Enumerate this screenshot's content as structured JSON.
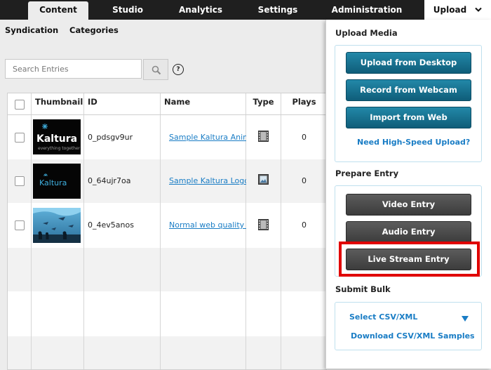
{
  "nav": {
    "tabs": [
      {
        "label": "Content",
        "active": true
      },
      {
        "label": "Studio"
      },
      {
        "label": "Analytics"
      },
      {
        "label": "Settings"
      },
      {
        "label": "Administration"
      },
      {
        "label": "Upload",
        "icon": "chevron-down-icon"
      }
    ]
  },
  "subnav": {
    "items": [
      "Syndication",
      "Categories"
    ]
  },
  "search": {
    "placeholder": "Search Entries",
    "button_icon": "search-icon",
    "help_icon": "help-icon",
    "help_glyph": "?"
  },
  "table": {
    "columns": [
      "Thumbnail",
      "ID",
      "Name",
      "Type",
      "Plays"
    ],
    "rows": [
      {
        "id": "0_pdsgv9ur",
        "name": "Sample Kaltura Animated Logo",
        "type_icon": "video-icon",
        "plays": "0",
        "thumb_logo": "Kaltura",
        "thumb_tagline": "everything together"
      },
      {
        "id": "0_64ujr7oa",
        "name": "Sample Kaltura Logo",
        "type_icon": "image-icon",
        "plays": "0",
        "thumb_logo": "Kaltura",
        "thumb_tagline": ""
      },
      {
        "id": "0_4ev5anos",
        "name": "Normal web quality video",
        "type_icon": "video-icon",
        "plays": "0",
        "thumb_logo": "",
        "thumb_tagline": ""
      }
    ]
  },
  "upload_panel": {
    "upload_media": {
      "title": "Upload Media",
      "buttons": [
        "Upload from Desktop",
        "Record from Webcam",
        "Import from Web"
      ],
      "link": "Need High-Speed Upload?"
    },
    "prepare_entry": {
      "title": "Prepare Entry",
      "buttons": [
        "Video Entry",
        "Audio Entry",
        "Live Stream Entry"
      ],
      "highlighted": "Live Stream Entry",
      "highlight_color": "#e00000"
    },
    "submit_bulk": {
      "title": "Submit Bulk",
      "select": "Select CSV/XML",
      "select_icon": "triangle-down-icon",
      "download": "Download CSV/XML Samples"
    }
  },
  "colors": {
    "topbar": "#1f1f1f",
    "accent_blue": "#1a7dc5",
    "button_blue": "#1a7394",
    "button_grey": "#4a4a4a"
  }
}
